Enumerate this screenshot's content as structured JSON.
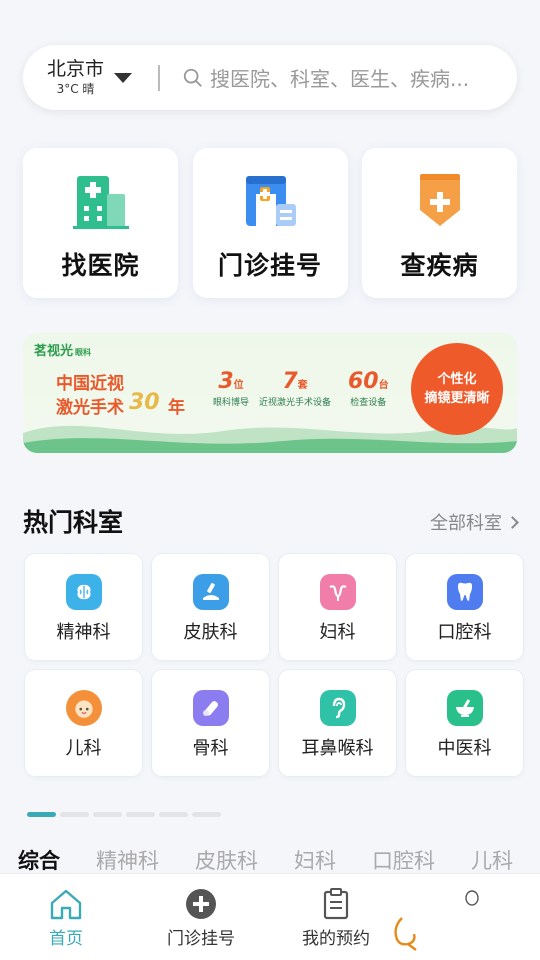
{
  "search": {
    "city": "北京市",
    "weather": "3°C 晴",
    "placeholder": "搜医院、科室、医生、疾病..."
  },
  "quick": [
    {
      "label": "找医院",
      "icon": "hospital-building-icon"
    },
    {
      "label": "门诊挂号",
      "icon": "clinic-registration-icon"
    },
    {
      "label": "查疾病",
      "icon": "disease-shield-icon"
    }
  ],
  "banner": {
    "brand": "茗视光",
    "brand_sub": "眼科",
    "line1": "中国近视",
    "line2": "激光手术",
    "years_num": "30",
    "years_suffix": "年",
    "stats": [
      {
        "num": "3",
        "unit": "位",
        "desc": "眼科博导"
      },
      {
        "num": "7",
        "unit": "套",
        "desc": "近视激光手术设备"
      },
      {
        "num": "60",
        "unit": "台",
        "desc": "检查设备"
      }
    ],
    "bubble_line1": "个性化",
    "bubble_line2": "摘镜更清晰"
  },
  "departments": {
    "title": "热门科室",
    "more": "全部科室",
    "items": [
      {
        "label": "精神科",
        "icon": "brain-icon",
        "color": "#3db2e8"
      },
      {
        "label": "皮肤科",
        "icon": "skin-icon",
        "color": "#3b9ee6"
      },
      {
        "label": "妇科",
        "icon": "uterus-icon",
        "color": "#f07ea8"
      },
      {
        "label": "口腔科",
        "icon": "tooth-icon",
        "color": "#4f7df0"
      },
      {
        "label": "儿科",
        "icon": "baby-icon",
        "color": "#f5903a"
      },
      {
        "label": "骨科",
        "icon": "bone-icon",
        "color": "#8b7cf0"
      },
      {
        "label": "耳鼻喉科",
        "icon": "ear-icon",
        "color": "#2fc2a8"
      },
      {
        "label": "中医科",
        "icon": "mortar-icon",
        "color": "#29c08c"
      }
    ]
  },
  "tabs": [
    "综合",
    "精神科",
    "皮肤科",
    "妇科",
    "口腔科",
    "儿科"
  ],
  "nav": [
    {
      "label": "首页",
      "icon": "home-icon"
    },
    {
      "label": "门诊挂号",
      "icon": "plus-circle-icon"
    },
    {
      "label": "我的预约",
      "icon": "clipboard-icon"
    }
  ],
  "colors": {
    "accent": "#3aaab8",
    "hospital": "#2fbf8f",
    "clinic": "#3b8ef0",
    "disease": "#f08a2a"
  }
}
